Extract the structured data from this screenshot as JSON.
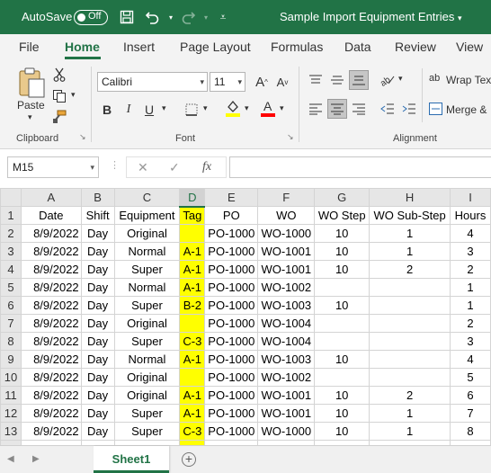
{
  "titlebar": {
    "autosave_label": "AutoSave",
    "autosave_state": "Off",
    "doc_title": "Sample Import Equipment Entries",
    "accent": "#217346"
  },
  "tabs": [
    "File",
    "Home",
    "Insert",
    "Page Layout",
    "Formulas",
    "Data",
    "Review",
    "View"
  ],
  "active_tab": "Home",
  "ribbon": {
    "clipboard": {
      "paste_label": "Paste",
      "group_label": "Clipboard"
    },
    "font": {
      "family": "Calibri",
      "size": "11",
      "group_label": "Font",
      "highlight_color": "#ffff00",
      "font_color": "#ff0000"
    },
    "alignment": {
      "wrap_label": "Wrap Text",
      "merge_label": "Merge &",
      "group_label": "Alignment"
    }
  },
  "formula_bar": {
    "cell_ref": "M15",
    "fx_label": "fx",
    "value": ""
  },
  "sheet": {
    "columns": [
      "A",
      "B",
      "C",
      "D",
      "E",
      "F",
      "G",
      "H",
      "I"
    ],
    "selected_column": "D",
    "header_row": [
      "Date",
      "Shift",
      "Equipment",
      "Tag",
      "PO",
      "WO",
      "WO Step",
      "WO Sub-Step",
      "Hours"
    ],
    "rows": [
      [
        "8/9/2022",
        "Day",
        "Original",
        "",
        "PO-1000",
        "WO-1000",
        "10",
        "1",
        "4"
      ],
      [
        "8/9/2022",
        "Day",
        "Normal",
        "A-1",
        "PO-1000",
        "WO-1001",
        "10",
        "1",
        "3"
      ],
      [
        "8/9/2022",
        "Day",
        "Super",
        "A-1",
        "PO-1000",
        "WO-1001",
        "10",
        "2",
        "2"
      ],
      [
        "8/9/2022",
        "Day",
        "Normal",
        "A-1",
        "PO-1000",
        "WO-1002",
        "",
        "",
        "1"
      ],
      [
        "8/9/2022",
        "Day",
        "Super",
        "B-2",
        "PO-1000",
        "WO-1003",
        "10",
        "",
        "1"
      ],
      [
        "8/9/2022",
        "Day",
        "Original",
        "",
        "PO-1000",
        "WO-1004",
        "",
        "",
        "2"
      ],
      [
        "8/9/2022",
        "Day",
        "Super",
        "C-3",
        "PO-1000",
        "WO-1004",
        "",
        "",
        "3"
      ],
      [
        "8/9/2022",
        "Day",
        "Normal",
        "A-1",
        "PO-1000",
        "WO-1003",
        "10",
        "",
        "4"
      ],
      [
        "8/9/2022",
        "Day",
        "Original",
        "",
        "PO-1000",
        "WO-1002",
        "",
        "",
        "5"
      ],
      [
        "8/9/2022",
        "Day",
        "Original",
        "A-1",
        "PO-1000",
        "WO-1001",
        "10",
        "2",
        "6"
      ],
      [
        "8/9/2022",
        "Day",
        "Super",
        "A-1",
        "PO-1000",
        "WO-1001",
        "10",
        "1",
        "7"
      ],
      [
        "8/9/2022",
        "Day",
        "Super",
        "C-3",
        "PO-1000",
        "WO-1000",
        "10",
        "1",
        "8"
      ]
    ],
    "highlight_color": "#ffff00"
  },
  "sheet_tabs": {
    "active": "Sheet1",
    "add_label": "+"
  }
}
